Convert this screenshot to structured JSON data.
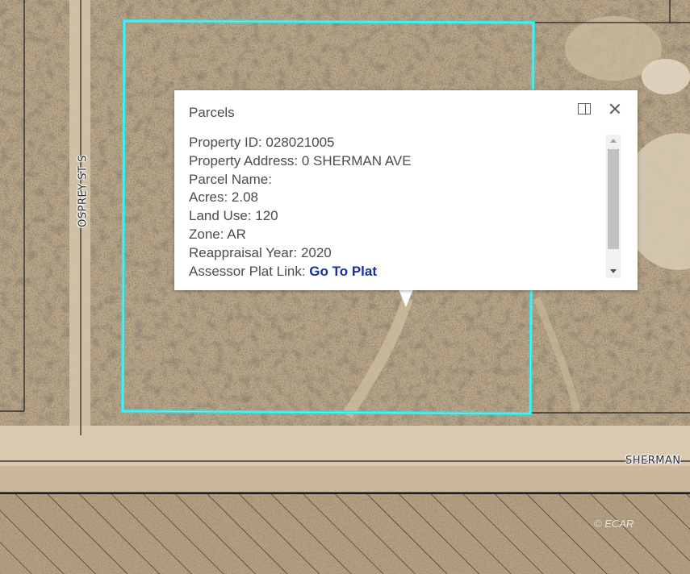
{
  "map": {
    "street_labels": {
      "osprey": "OSPREY ST S",
      "sherman": "SHERMAN"
    },
    "copyright": "© ECAR",
    "colors": {
      "parcel_highlight": "#2fe3e6",
      "terrain": "#b9a588",
      "vegetation": "#3b3326",
      "road": "#d6c6ad"
    }
  },
  "popup": {
    "title": "Parcels",
    "dock_icon": "dock-side-icon",
    "close_icon": "close-icon",
    "attributes": [
      {
        "label": "Property ID: ",
        "value": "028021005"
      },
      {
        "label": "Property Address: ",
        "value": "0 SHERMAN AVE"
      },
      {
        "label": "Parcel Name: ",
        "value": ""
      },
      {
        "label": "Acres: ",
        "value": "2.08"
      },
      {
        "label": "Land Use: ",
        "value": "120"
      },
      {
        "label": "Zone: ",
        "value": "AR"
      },
      {
        "label": "Reappraisal Year: ",
        "value": "2020"
      }
    ],
    "plat_link": {
      "label": "Assessor Plat Link: ",
      "link_text": "Go To Plat"
    }
  }
}
